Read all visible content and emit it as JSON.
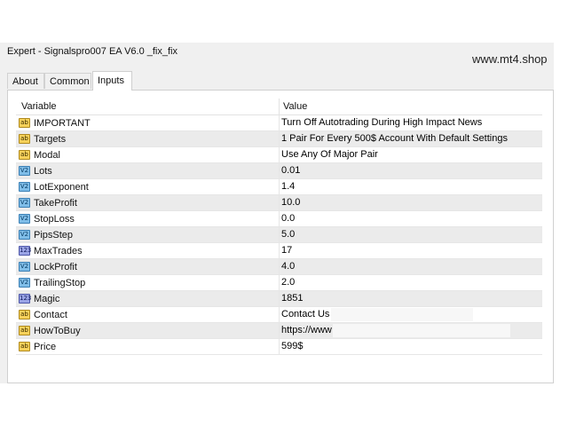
{
  "window": {
    "title": "Expert - Signalspro007 EA V6.0 _fix_fix"
  },
  "watermark": "www.mt4.shop",
  "tabs": [
    {
      "label": "About",
      "active": false
    },
    {
      "label": "Common",
      "active": false
    },
    {
      "label": "Inputs",
      "active": true
    }
  ],
  "table": {
    "headers": {
      "variable": "Variable",
      "value": "Value"
    },
    "rows": [
      {
        "icon": "ab",
        "name": "IMPORTANT",
        "value": "Turn Off Autotrading During High Impact News"
      },
      {
        "icon": "ab",
        "name": "Targets",
        "value": "1 Pair For Every 500$ Account With Default Settings"
      },
      {
        "icon": "ab",
        "name": "Modal",
        "value": "Use Any Of Major Pair"
      },
      {
        "icon": "v2",
        "name": "Lots",
        "value": "0.01"
      },
      {
        "icon": "v2",
        "name": "LotExponent",
        "value": "1.4"
      },
      {
        "icon": "v2",
        "name": "TakeProfit",
        "value": "10.0"
      },
      {
        "icon": "v2",
        "name": "StopLoss",
        "value": "0.0"
      },
      {
        "icon": "v2",
        "name": "PipsStep",
        "value": "5.0"
      },
      {
        "icon": "123",
        "name": "MaxTrades",
        "value": "17"
      },
      {
        "icon": "v2",
        "name": "LockProfit",
        "value": "4.0"
      },
      {
        "icon": "v2",
        "name": "TrailingStop",
        "value": "2.0"
      },
      {
        "icon": "123",
        "name": "Magic",
        "value": "1851"
      },
      {
        "icon": "ab",
        "name": "Contact",
        "value": "Contact Us"
      },
      {
        "icon": "ab",
        "name": "HowToBuy",
        "value": "https://www"
      },
      {
        "icon": "ab",
        "name": "Price",
        "value": "599$"
      }
    ]
  },
  "icon_names": {
    "ab": "string-param-icon",
    "v2": "double-param-icon",
    "123": "integer-param-icon"
  },
  "colors": {
    "window_bg": "#f0f0f0",
    "row_alt": "#ebebeb",
    "string_icon": "#f6d15a",
    "double_icon": "#7fbde8",
    "int_icon": "#9aa4e6"
  }
}
